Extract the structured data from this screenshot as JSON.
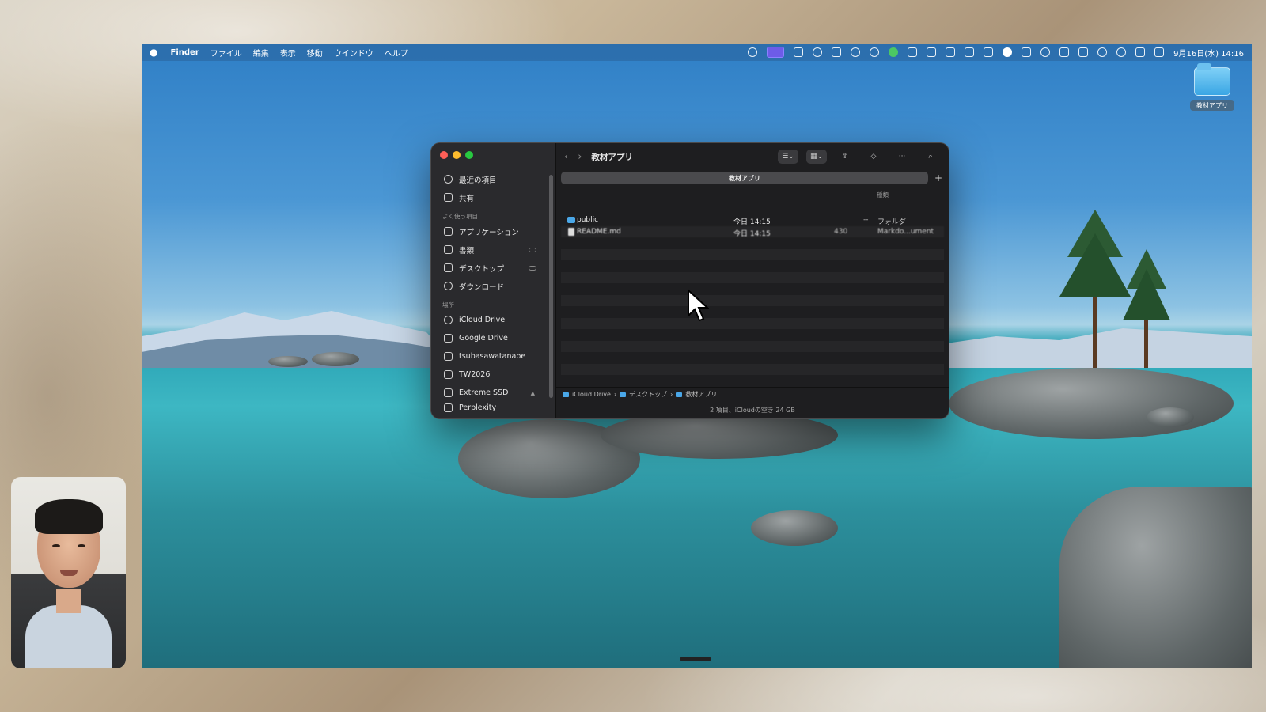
{
  "menubar": {
    "app_name": "Finder",
    "menus": [
      "ファイル",
      "編集",
      "表示",
      "移動",
      "ウインドウ",
      "ヘルプ"
    ],
    "clock": "9月16日(水) 14:16"
  },
  "desktop": {
    "folder_label": "教材アプリ"
  },
  "finder": {
    "window_title": "教材アプリ",
    "tab_label": "教材アプリ",
    "column_kind_header": "種類",
    "sidebar": {
      "recent": "最近の項目",
      "shared": "共有",
      "favorites_header": "よく使う項目",
      "applications": "アプリケーション",
      "documents": "書類",
      "desktop": "デスクトップ",
      "downloads": "ダウンロード",
      "locations_header": "場所",
      "icloud_drive": "iCloud Drive",
      "google_drive": "Google Drive",
      "home": "tsubasawatanabe",
      "tw2026": "TW2026",
      "extreme_ssd": "Extreme SSD",
      "perplexity": "Perplexity"
    },
    "files": [
      {
        "name": "public",
        "date": "今日 14:15",
        "size": "--",
        "kind": "フォルダ"
      },
      {
        "name": "README.md",
        "date": "今日 14:15",
        "size": "430",
        "kind": "Markdo...ument"
      }
    ],
    "path": [
      "iCloud Drive",
      "デスクトップ",
      "教材アプリ"
    ],
    "status": "2 項目、iCloudの空き 24 GB"
  }
}
